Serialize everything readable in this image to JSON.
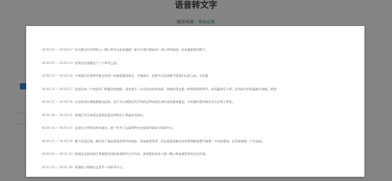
{
  "page": {
    "title": "语音转文字",
    "tabs": [
      {
        "label": "翻译结果"
      },
      {
        "label": "导出记录"
      }
    ]
  },
  "transcript": [
    {
      "time": "00:00:00 ~ 00:00:07",
      "text": "在内蒙古的大草原上一棵小草可以有多重要？能今天我们就来讲一讲小草的秘密，先来看看我的脚下。"
    },
    {
      "time": "00:00:07 ~ 00:00:10",
      "text": "找到这些便跟这了一个草坪上面。"
    },
    {
      "time": "00:00:10 ~ 00:00:16",
      "text": "平常我们见到草坪都会觉得一些像是要很高去，不能踩它，但是今天这里都不是我们以前上来，大家看"
    },
    {
      "time": "00:00:16 ~ 00:00:27",
      "text": "这里还有一个些研学门得着协定踏饭，我也是头一次见到这样的场面，那就这里这是一种感到我的草坪，也叫着快乐小草，因为研它的秋着都方便随，那就"
    },
    {
      "time": "00:00:27 ~ 00:00:36",
      "text": "从比如现在就能都能过起来，这个怎么就是因为不同的品种或是在来的适合都来看出，它的最好是用来也可以去到小草里。"
    },
    {
      "time": "00:00:36 ~ 00:00:41",
      "text": "那就们今天来到这里那也是这种快乐小草诞生的地方。"
    },
    {
      "time": "00:00:41 ~ 00:00:47",
      "text": "这里位于呼和浩特市境内，是一些专门从事草种生态保育的研发与科研中心。"
    },
    {
      "time": "00:00:47 ~ 00:00:56",
      "text": "整个项目区域，都利用了基因是使用草坪的改良，到处都是草草，而这里是把最适合的草种都放置不像是一个科研基地，反而更像是一个生态园。"
    },
    {
      "time": "00:00:56 ~ 00:01:03",
      "text": "那就这这里的快乐草都是利用的普通草坪分不开的，那就是给很多人都一颗小草来感受草的生态环境。"
    },
    {
      "time": "00:01:03 ~ 00:01:08",
      "text": "草通的小草都在这里不一样的不平凡。"
    }
  ]
}
